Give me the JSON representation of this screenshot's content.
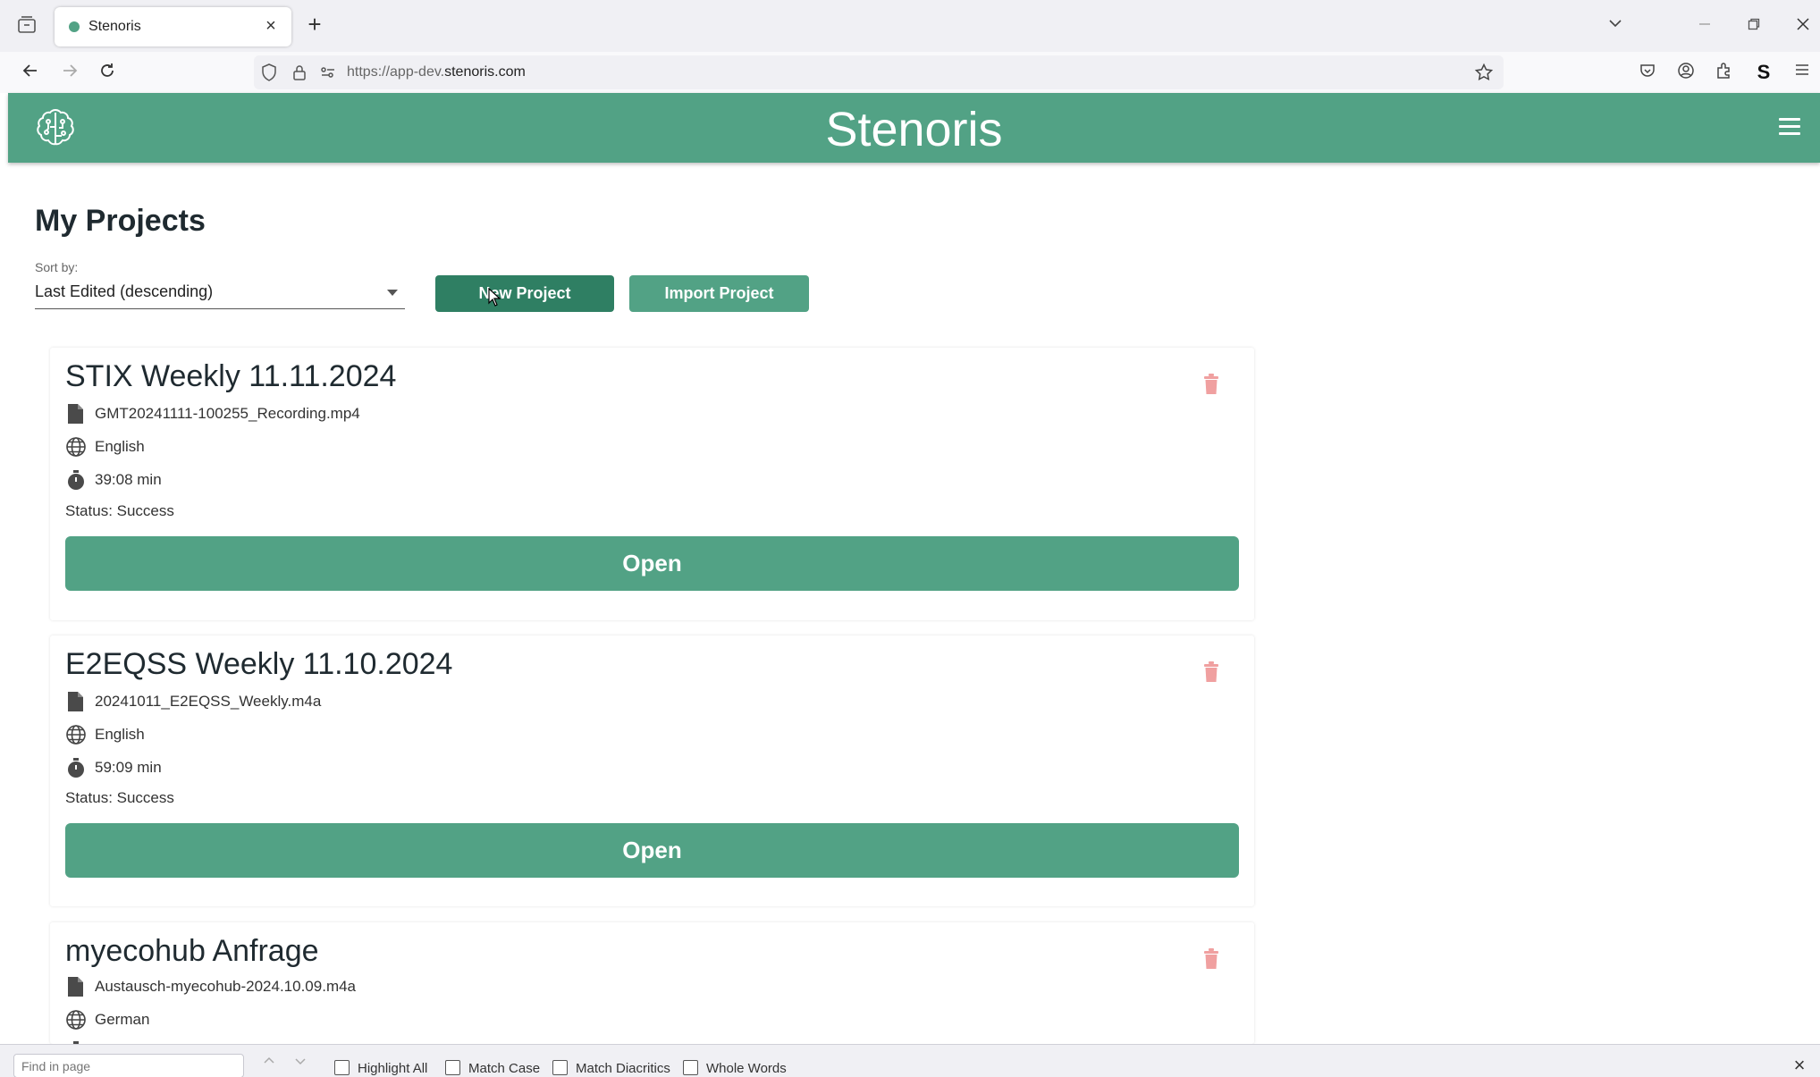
{
  "browser": {
    "tab_title": "Stenoris",
    "url_prefix": "https://app-dev.",
    "url_domain": "stenoris.com"
  },
  "app": {
    "title": "Stenoris",
    "brand_color": "#52a285"
  },
  "page": {
    "title": "My Projects",
    "sort_label": "Sort by:",
    "sort_value": "Last Edited (descending)",
    "new_project_label": "New Project",
    "import_project_label": "Import Project"
  },
  "projects": [
    {
      "title": "STIX Weekly 11.11.2024",
      "file": "GMT20241111-100255_Recording.mp4",
      "language": "English",
      "duration": "39:08 min",
      "status": "Status: Success",
      "open_label": "Open"
    },
    {
      "title": "E2EQSS Weekly 11.10.2024",
      "file": "20241011_E2EQSS_Weekly.m4a",
      "language": "English",
      "duration": "59:09 min",
      "status": "Status: Success",
      "open_label": "Open"
    },
    {
      "title": "myecohub Anfrage",
      "file": "Austausch-myecohub-2024.10.09.m4a",
      "language": "German"
    }
  ],
  "findbar": {
    "placeholder": "Find in page",
    "highlight_all": "Highlight All",
    "match_case": "Match Case",
    "match_diacritics": "Match Diacritics",
    "whole_words": "Whole Words"
  }
}
